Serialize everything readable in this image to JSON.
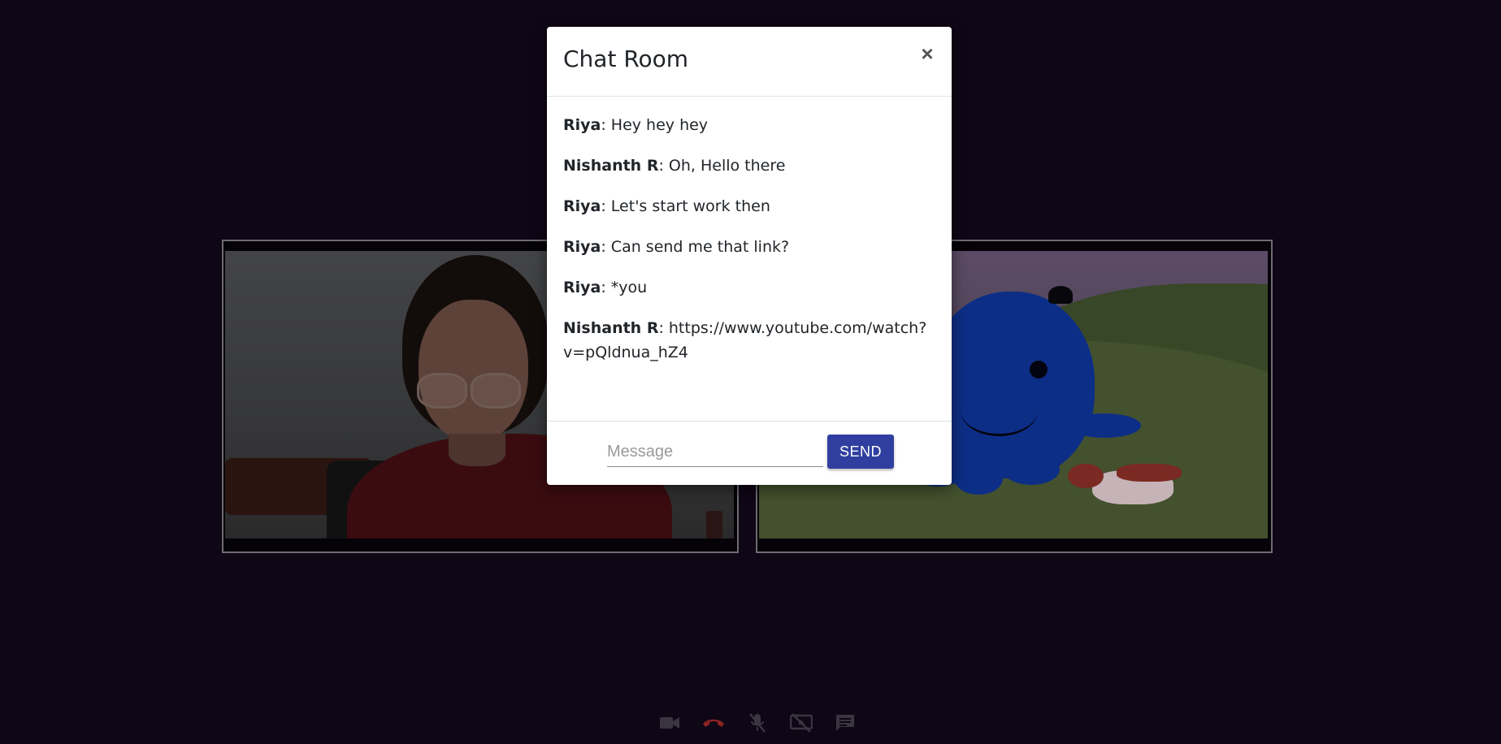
{
  "modal": {
    "title": "Chat Room",
    "close_symbol": "×",
    "messages": [
      {
        "sender": "Riya",
        "text": ": Hey hey hey"
      },
      {
        "sender": "Nishanth R",
        "text": ": Oh, Hello there"
      },
      {
        "sender": "Riya",
        "text": ": Let's start work then"
      },
      {
        "sender": "Riya",
        "text": ": Can send me that link?"
      },
      {
        "sender": "Riya",
        "text": ": *you"
      },
      {
        "sender": "Nishanth R",
        "text": ": https://www.youtube.com/watch?v=pQldnua_hZ4"
      }
    ],
    "input_placeholder": "Message",
    "send_label": "SEND"
  },
  "controls": [
    {
      "icon": "video-camera-icon",
      "color": "#3a3540"
    },
    {
      "icon": "hang-up-icon",
      "color": "#8c2323"
    },
    {
      "icon": "mic-off-icon",
      "color": "#3a3540"
    },
    {
      "icon": "screen-share-off-icon",
      "color": "#3a3540"
    },
    {
      "icon": "chat-icon",
      "color": "#3a3540"
    }
  ],
  "colors": {
    "background": "#0f0616",
    "accent": "#303f9f",
    "tile_border": "#6e6c70"
  }
}
